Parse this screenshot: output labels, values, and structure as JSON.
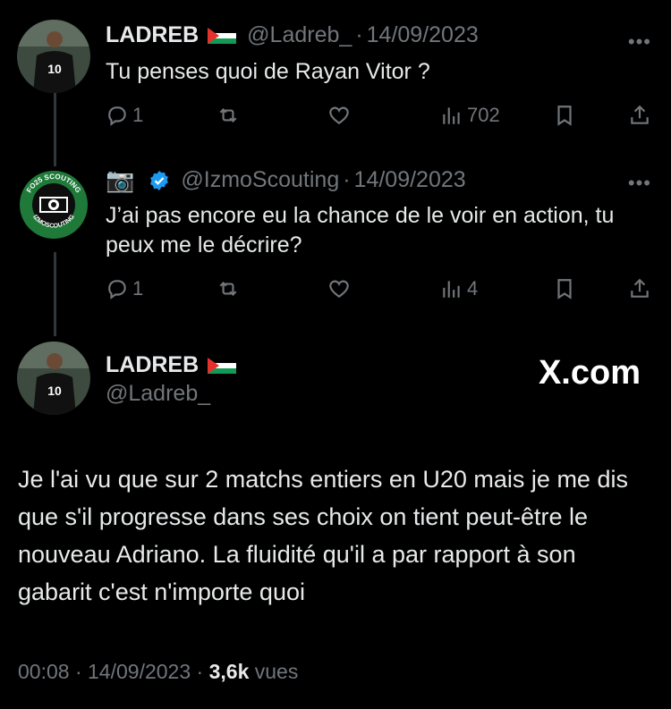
{
  "tweet1": {
    "name": "LADREB",
    "handle": "@Ladreb_",
    "date": "14/09/2023",
    "text": "Tu penses quoi de Rayan Vitor ?",
    "replies": "1",
    "views": "702"
  },
  "tweet2": {
    "name_emoji": "📷",
    "handle": "@IzmoScouting",
    "date": "14/09/2023",
    "text": "J’ai pas encore eu la chance de le voir en action, tu peux me le décrire?",
    "replies": "1",
    "views": "4",
    "avatar_text_top": "FO25 SCOUTING",
    "avatar_text_bottom": "IZMOSCOUTING"
  },
  "main": {
    "name": "LADREB",
    "handle": "@Ladreb_",
    "text": "Je l'ai vu que sur 2 matchs entiers en U20 mais je me dis que s'il progresse dans ses choix on tient peut-être le nouveau Adriano. La fluidité qu'il a par rapport à son gabarit c'est n'importe quoi",
    "time": "00:08",
    "date": "14/09/2023",
    "views_count": "3,6k",
    "views_label": "vues"
  },
  "watermark": "X.com",
  "sep": "·",
  "more_glyph": "•••",
  "colors": {
    "background": "#000000",
    "text": "#e7e9ea",
    "muted": "#71767b",
    "verified": "#1d9bf0",
    "scout_green": "#1f7a3a"
  },
  "icons": [
    "reply-icon",
    "retweet-icon",
    "like-icon",
    "views-icon",
    "bookmark-icon",
    "share-icon",
    "verified-icon",
    "flag-icon",
    "more-icon"
  ]
}
